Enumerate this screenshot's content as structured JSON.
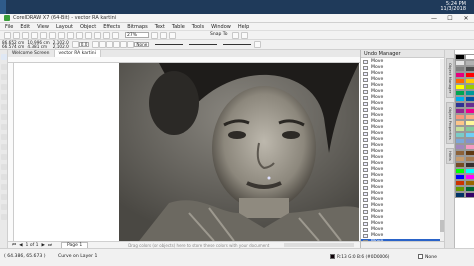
{
  "os": {
    "clock_time": "5:24 PM",
    "clock_date": "11/3/2018"
  },
  "window": {
    "title": "CorelDRAW X7 (64-Bit) - vector RA kartini",
    "min": "—",
    "max": "☐",
    "close": "✕"
  },
  "menu": [
    "File",
    "Edit",
    "View",
    "Layout",
    "Object",
    "Effects",
    "Bitmaps",
    "Text",
    "Table",
    "Tools",
    "Window",
    "Help"
  ],
  "toolbar": {
    "zoom": "27%",
    "snap_to": "Snap To"
  },
  "propbar": {
    "x": "86.652 cm",
    "y": "66.574 cm",
    "width": "10.996 cm",
    "height": "4.381 cm",
    "scale_x": "2,102.0",
    "scale_y": "2,102.0",
    "angle": "0.0",
    "outline_width": "None"
  },
  "doc_tabs": [
    "Welcome Screen",
    "vector RA kartini"
  ],
  "pagebar": {
    "page_count": "1 of 1",
    "page_tab": "Page 1",
    "hint": "Drag colors (or objects) here to store these colors with your document"
  },
  "undo_manager": {
    "title": "Undo Manager",
    "items": [
      "Move",
      "Move",
      "Move",
      "Move",
      "Move",
      "Move",
      "Move",
      "Move",
      "Move",
      "Move",
      "Move",
      "Move",
      "Move",
      "Move",
      "Move",
      "Move",
      "Move",
      "Move",
      "Move",
      "Move",
      "Move",
      "Move",
      "Move",
      "Move",
      "Move",
      "Move",
      "Move",
      "Move",
      "Move",
      "Move",
      "Move"
    ],
    "selected_index": 30
  },
  "side_tabs": [
    "Object Manager",
    "Object Properties",
    "Hints"
  ],
  "palette": [
    "#000000",
    "#ffffff",
    "#e6e6e6",
    "#b3b3b3",
    "#808080",
    "#4d4d4d",
    "#e5007e",
    "#ff0000",
    "#ff6600",
    "#ffcc00",
    "#ffff00",
    "#99cc00",
    "#00a651",
    "#009999",
    "#00aeef",
    "#0054a6",
    "#2e3192",
    "#662d91",
    "#92278f",
    "#ec008c",
    "#f7977a",
    "#fbad82",
    "#fdc68a",
    "#fff79a",
    "#c4df9b",
    "#82ca9c",
    "#7accc8",
    "#6dcff6",
    "#7da7d8",
    "#8493ca",
    "#a187be",
    "#f49ac2",
    "#8c6239",
    "#603913",
    "#c69c6d",
    "#a67c52",
    "#754c24",
    "#362f2d",
    "#00ff00",
    "#00ffff",
    "#0000ff",
    "#ff00ff",
    "#cc3300",
    "#996600",
    "#669900",
    "#006633",
    "#003366",
    "#330066"
  ],
  "status": {
    "coords": "( 64.386, 65.673 )",
    "layer": "Curve on Layer 1",
    "color": "R:13 G:0 B:6 (#0D0006)",
    "fill": "None"
  }
}
